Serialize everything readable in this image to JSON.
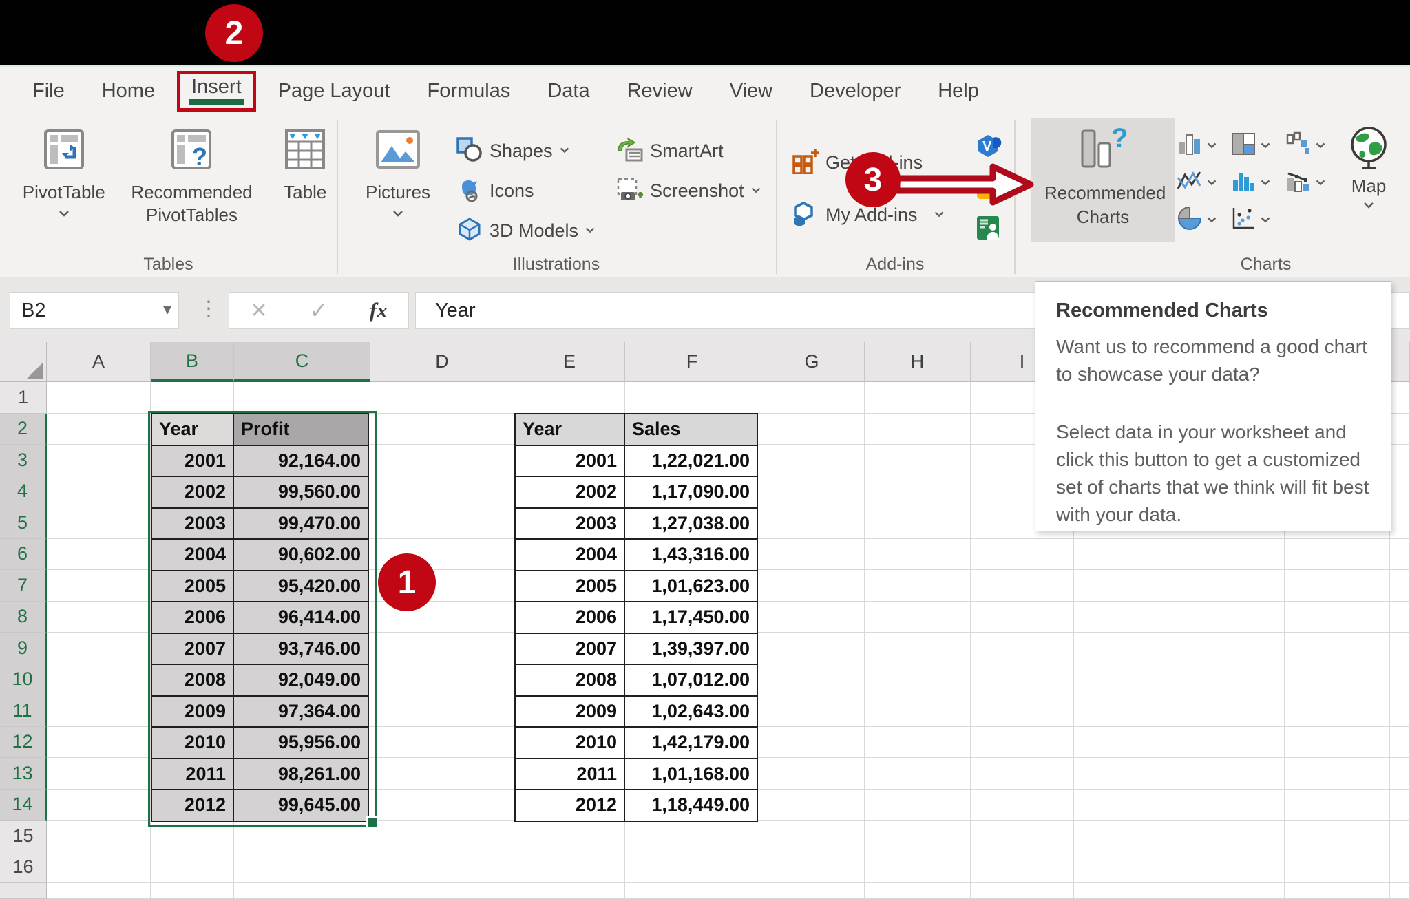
{
  "tabs": {
    "items": [
      "File",
      "Home",
      "Insert",
      "Page Layout",
      "Formulas",
      "Data",
      "Review",
      "View",
      "Developer",
      "Help"
    ],
    "active": "Insert"
  },
  "ribbon": {
    "tables": {
      "label": "Tables",
      "pivottable": "PivotTable",
      "recommended_pivottables": "Recommended PivotTables",
      "table": "Table"
    },
    "illustrations": {
      "label": "Illustrations",
      "pictures": "Pictures",
      "shapes": "Shapes",
      "icons": "Icons",
      "models": "3D Models",
      "smartart": "SmartArt",
      "screenshot": "Screenshot"
    },
    "addins": {
      "label": "Add-ins",
      "get_addins": "Get Add-ins",
      "my_addins": "My Add-ins"
    },
    "charts": {
      "label": "Charts",
      "recommended_charts": "Recommended Charts",
      "map": "Map"
    }
  },
  "formula_bar": {
    "name_box": "B2",
    "fx": "fx",
    "value": "Year"
  },
  "sheet": {
    "col_letters": [
      "A",
      "B",
      "C",
      "D",
      "E",
      "F",
      "G",
      "H",
      "I"
    ],
    "selected_cols": [
      "B",
      "C"
    ],
    "row_numbers": [
      "1",
      "2",
      "3",
      "4",
      "5",
      "6",
      "7",
      "8",
      "9",
      "10",
      "11",
      "12",
      "13",
      "14",
      "15",
      "16"
    ],
    "selected_rows": [
      "2",
      "3",
      "4",
      "5",
      "6",
      "7",
      "8",
      "9",
      "10",
      "11",
      "12",
      "13",
      "14"
    ],
    "left_table": {
      "headers": [
        "Year",
        "Profit"
      ],
      "years": [
        "2001",
        "2002",
        "2003",
        "2004",
        "2005",
        "2006",
        "2007",
        "2008",
        "2009",
        "2010",
        "2011",
        "2012"
      ],
      "values": [
        "92,164.00",
        "99,560.00",
        "99,470.00",
        "90,602.00",
        "95,420.00",
        "96,414.00",
        "93,746.00",
        "92,049.00",
        "97,364.00",
        "95,956.00",
        "98,261.00",
        "99,645.00"
      ]
    },
    "right_table": {
      "headers": [
        "Year",
        "Sales"
      ],
      "years": [
        "2001",
        "2002",
        "2003",
        "2004",
        "2005",
        "2006",
        "2007",
        "2008",
        "2009",
        "2010",
        "2011",
        "2012"
      ],
      "values": [
        "1,22,021.00",
        "1,17,090.00",
        "1,27,038.00",
        "1,43,316.00",
        "1,01,623.00",
        "1,17,450.00",
        "1,39,397.00",
        "1,07,012.00",
        "1,02,643.00",
        "1,42,179.00",
        "1,01,168.00",
        "1,18,449.00"
      ]
    }
  },
  "callouts": {
    "one": "1",
    "two": "2",
    "three": "3"
  },
  "tooltip": {
    "title": "Recommended Charts",
    "p1": "Want us to recommend a good chart to showcase your data?",
    "p2": "Select data in your worksheet and click this button to get a customized set of charts that we think will fit best with your data."
  },
  "colors": {
    "accent_green": "#1e7145",
    "accent_green_dark": "#1d6b43",
    "callout_red": "#c00713",
    "selection_fill": "#d4d2d2",
    "icon_blue": "#2e75b6",
    "icon_light_blue": "#5b9bd5"
  }
}
